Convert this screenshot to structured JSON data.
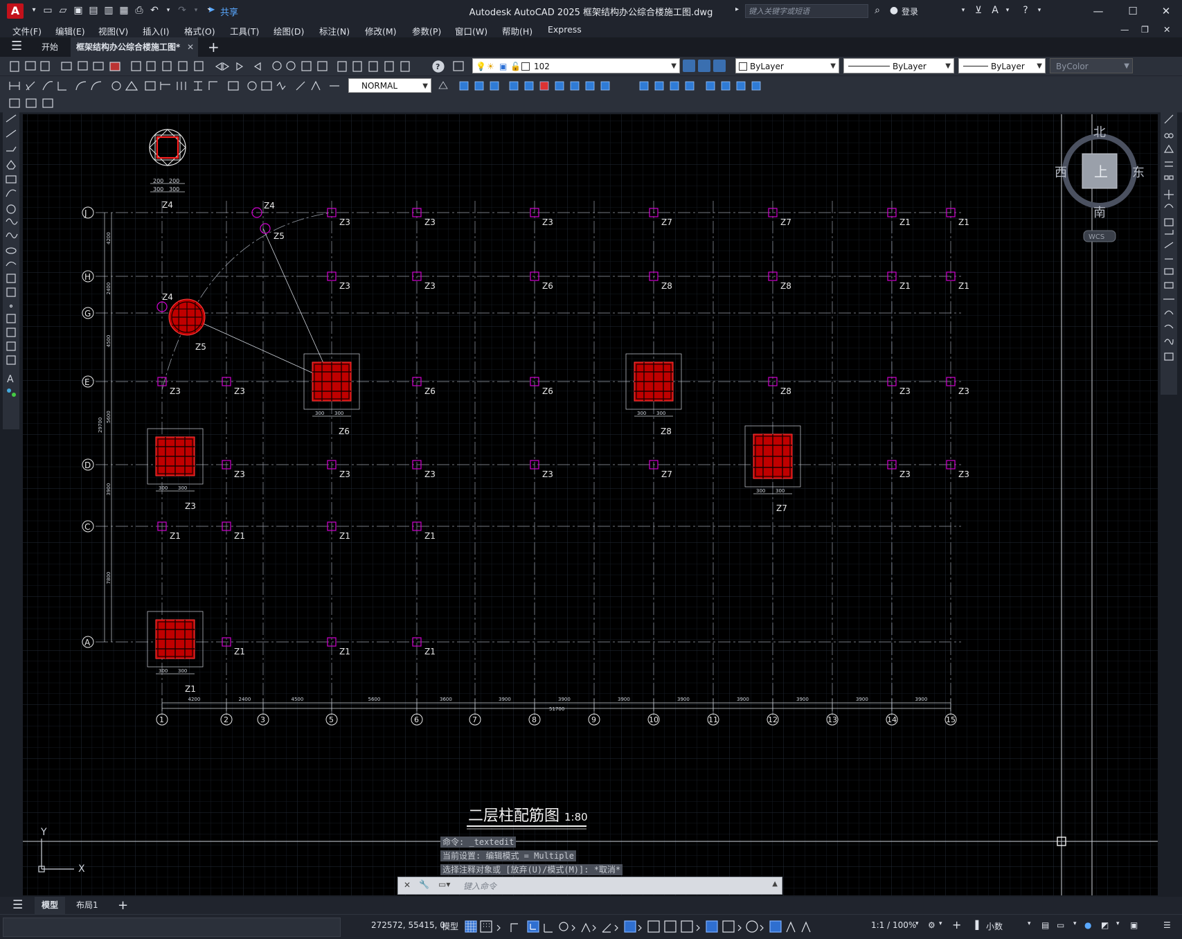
{
  "app": {
    "title": "Autodesk AutoCAD 2025    框架结构办公综合楼施工图.dwg",
    "share_label": "共享",
    "search_placeholder": "键入关键字或短语",
    "login_label": "登录"
  },
  "menu": [
    "文件(F)",
    "编辑(E)",
    "视图(V)",
    "插入(I)",
    "格式(O)",
    "工具(T)",
    "绘图(D)",
    "标注(N)",
    "修改(M)",
    "参数(P)",
    "窗口(W)",
    "帮助(H)",
    "Express"
  ],
  "tabs": {
    "start": "开始",
    "drawing": "框架结构办公综合楼施工图*"
  },
  "toolbar": {
    "layer_value": "102",
    "color_value": "ByLayer",
    "linetype_value": "ByLayer",
    "lineweight_value": "ByLayer",
    "plotstyle_value": "ByColor",
    "dimstyle_value": "NORMAL"
  },
  "viewcube": {
    "north": "北",
    "south": "南",
    "east": "东",
    "west": "西",
    "top": "上",
    "wcs": "WCS"
  },
  "drawing": {
    "title": "二层柱配筋图",
    "scale": "1:80",
    "grid_rows": [
      "J",
      "H",
      "G",
      "E",
      "D",
      "C",
      "A"
    ],
    "grid_cols": [
      "1",
      "2",
      "3",
      "5",
      "6",
      "7",
      "8",
      "9",
      "10",
      "11",
      "12",
      "13",
      "14",
      "15"
    ],
    "dims_bottom": [
      "4200",
      "2400",
      "4500",
      "5600",
      "3600",
      "3900",
      "3900",
      "3900",
      "3900",
      "3900",
      "3900",
      "3900",
      "3900"
    ],
    "dim_total": "51700",
    "dims_left": [
      "4200",
      "2400",
      "4500",
      "5600",
      "3900",
      "7800"
    ],
    "dim_left_total": "29700",
    "column_labels": [
      {
        "id": "Z4-top",
        "text": "Z4"
      },
      {
        "id": "Z5-arc",
        "text": "Z5"
      }
    ]
  },
  "command": {
    "history": [
      "命令: _textedit",
      "当前设置: 编辑模式 = Multiple",
      "选择注释对象或 [放弃(U)/模式(M)]: *取消*"
    ],
    "placeholder": "键入命令"
  },
  "layouts": {
    "model": "模型",
    "layout1": "布局1"
  },
  "status": {
    "coords": "272572, 55415, 0",
    "model_label": "模型",
    "annotation_scale": "1:1 / 100%",
    "units": "小数"
  },
  "colors": {
    "accent": "#c3111b",
    "canvas": "#000000",
    "grid": "#1d2430",
    "column": "#d000d0",
    "rebar": "#ff2020"
  }
}
